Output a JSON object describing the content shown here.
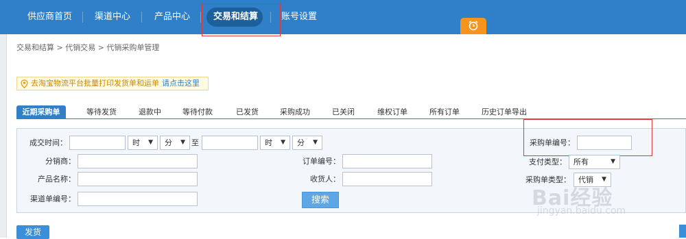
{
  "nav": {
    "items": [
      "供应商首页",
      "渠道中心",
      "产品中心",
      "交易和结算",
      "账号设置"
    ]
  },
  "breadcrumb": "交易和结算 > 代销交易 > 代销采购单管理",
  "notice": {
    "text": "去淘宝物流平台批量打印发货单和运单",
    "link": "请点击这里"
  },
  "tabs": [
    "近期采购单",
    "等待发货",
    "退款中",
    "等待付款",
    "已发货",
    "采购成功",
    "已关闭",
    "维权订单",
    "所有订单",
    "历史订单导出"
  ],
  "form": {
    "deal_time_label": "成交时间：",
    "hour": "时",
    "minute": "分",
    "to": "至",
    "distributor_label": "分销商：",
    "product_name_label": "产品名称：",
    "channel_order_label": "渠道单编号：",
    "order_no_label": "订单编号：",
    "receiver_label": "收货人：",
    "purchase_no_label": "采购单编号：",
    "pay_type_label": "支付类型：",
    "pay_type_value": "所有",
    "purchase_type_label": "采购单类型：",
    "purchase_type_value": "代销"
  },
  "buttons": {
    "search": "搜索",
    "ship": "发货"
  },
  "watermark": {
    "brand": "Bai",
    "brand2": "经验",
    "url": "jingyan.baidu.com"
  },
  "colors": {
    "primary": "#2f80c9",
    "highlight": "#e2383a",
    "bell": "#f7941d"
  }
}
